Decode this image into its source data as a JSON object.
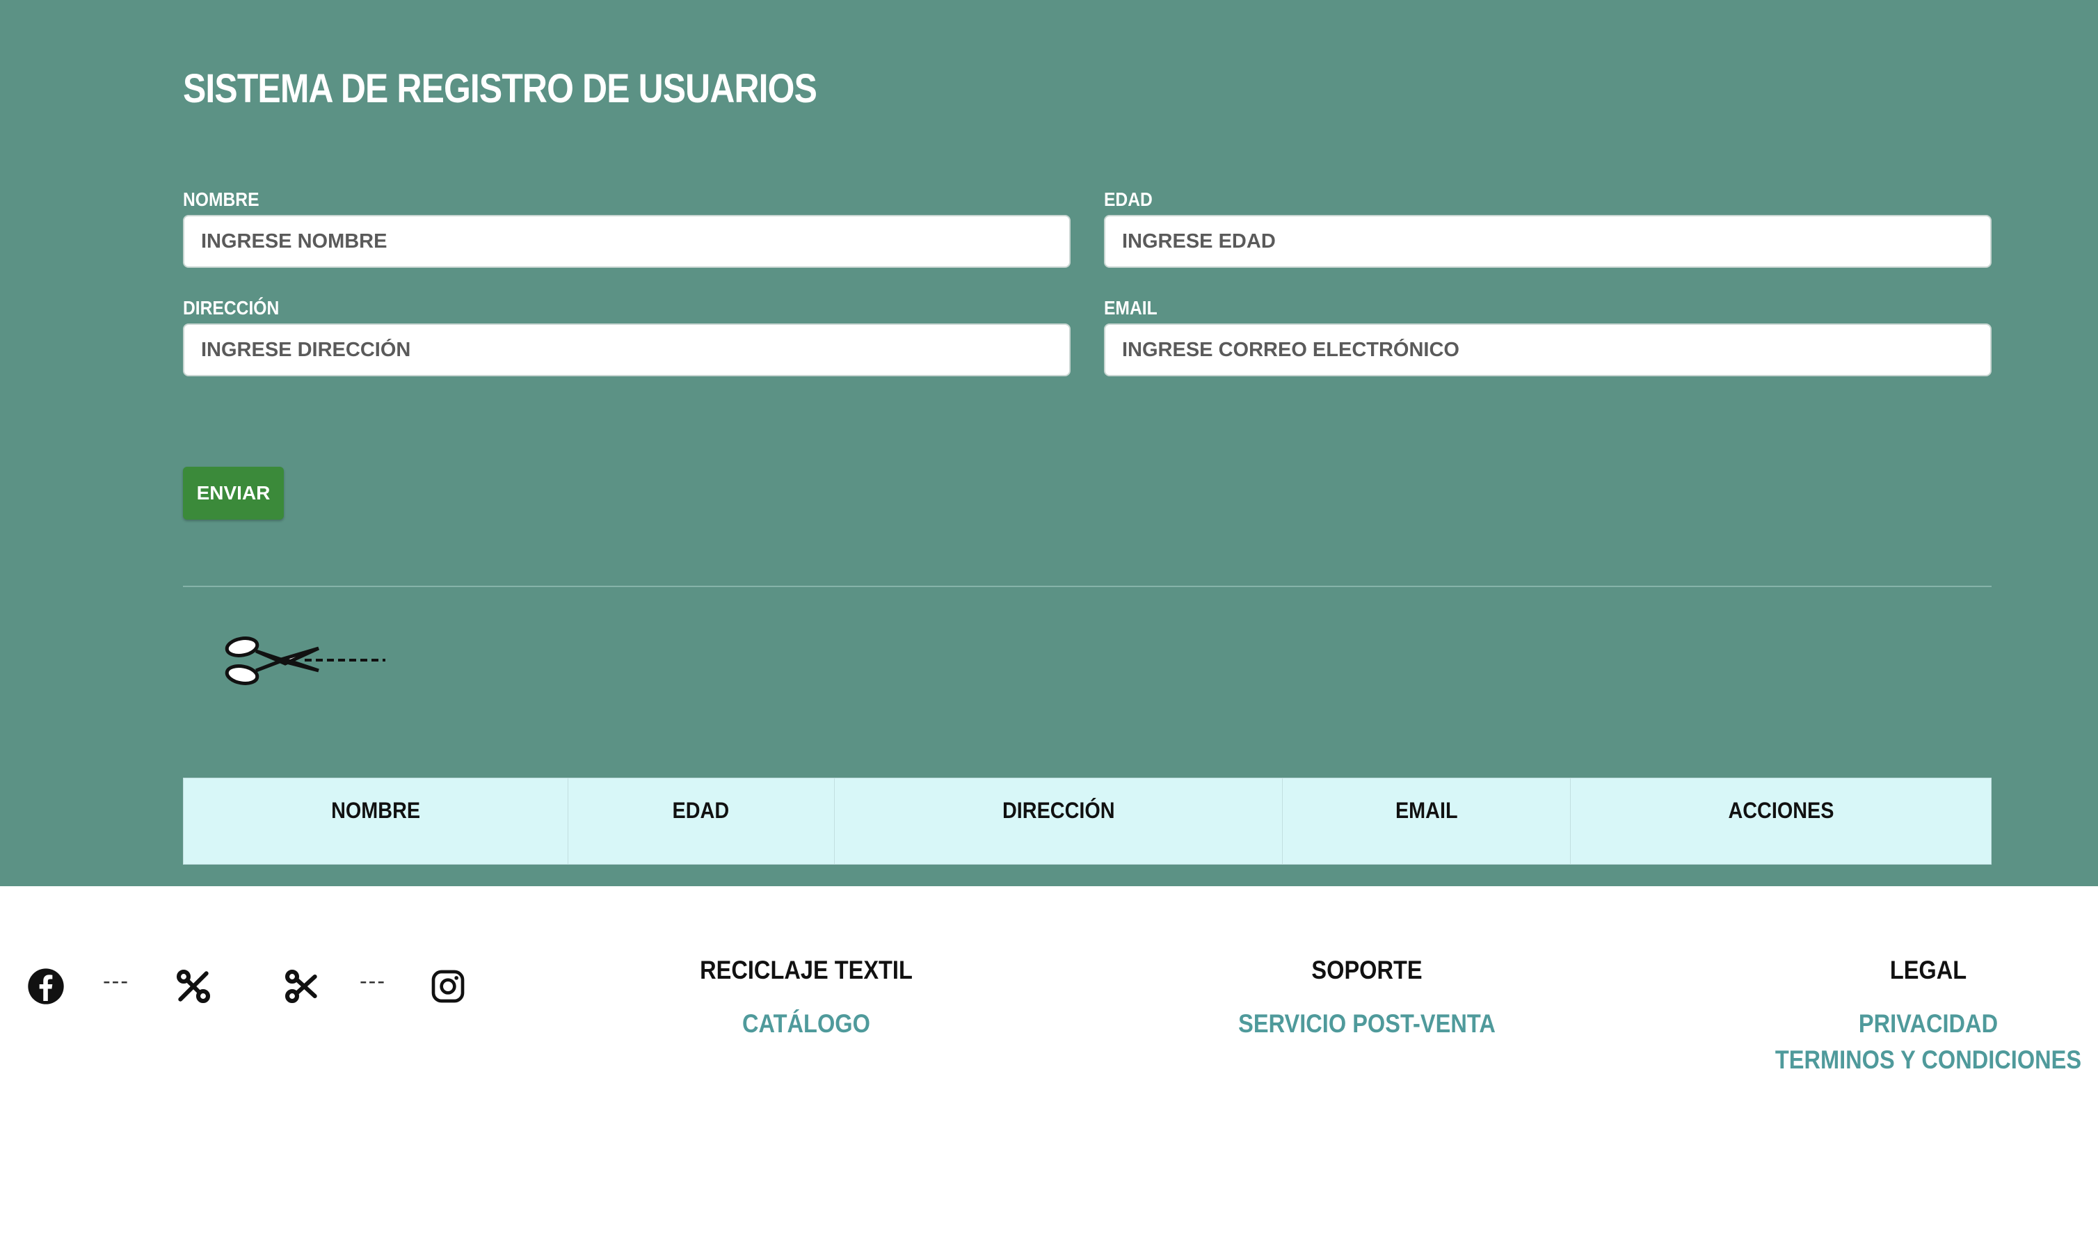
{
  "page": {
    "title": "SISTEMA DE REGISTRO DE USUARIOS",
    "background_color": "#5c9285"
  },
  "form": {
    "fields": [
      {
        "label": "NOMBRE",
        "placeholder": "INGRESE NOMBRE",
        "value": ""
      },
      {
        "label": "EDAD",
        "placeholder": "INGRESE EDAD",
        "value": ""
      },
      {
        "label": "DIRECCIÓN",
        "placeholder": "INGRESE DIRECCIÓN",
        "value": ""
      },
      {
        "label": "EMAIL",
        "placeholder": "INGRESE CORREO ELECTRÓNICO",
        "value": ""
      }
    ],
    "submit_label": "ENVIAR",
    "submit_color": "#3b8a3a"
  },
  "table": {
    "columns": [
      "NOMBRE",
      "EDAD",
      "DIRECCIÓN",
      "EMAIL",
      "ACCIONES"
    ],
    "rows": []
  },
  "footer": {
    "social_icons": [
      "facebook-icon",
      "tools-icon",
      "scissors-icon",
      "instagram-icon"
    ],
    "separator": "---",
    "columns": [
      {
        "heading": "RECICLAJE TEXTIL",
        "links": [
          "CATÁLOGO"
        ]
      },
      {
        "heading": "SOPORTE",
        "links": [
          "SERVICIO POST-VENTA"
        ]
      },
      {
        "heading": "LEGAL",
        "links": [
          "PRIVACIDAD",
          "TERMINOS Y CONDICIONES"
        ]
      }
    ],
    "link_color": "#4f9a9b"
  }
}
